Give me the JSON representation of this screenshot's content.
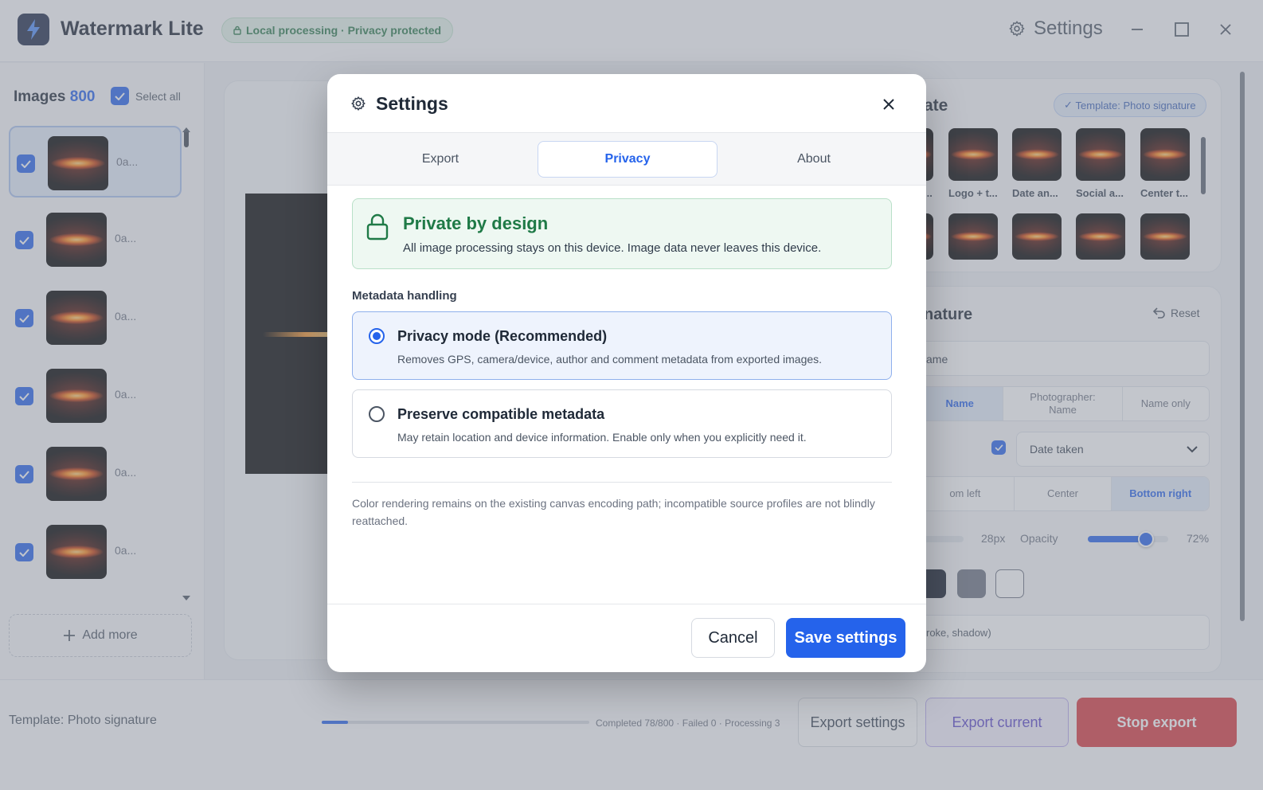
{
  "app": {
    "title": "Watermark Lite",
    "local_badge": "Local processing · Privacy protected",
    "settings_label": "Settings"
  },
  "left_panel": {
    "images_label": "Images",
    "images_count": "800",
    "select_all": "Select all",
    "thumb_name": "0a...",
    "add_more": "Add more"
  },
  "template_panel": {
    "title_fragment": "ate",
    "badge": "Template: Photo signature",
    "templates": [
      "...",
      "Logo + t...",
      "Date an...",
      "Social a...",
      "Center t..."
    ]
  },
  "signature_panel": {
    "title_fragment": "nature",
    "reset": "Reset",
    "name_input": "ame",
    "format_options": [
      "Name",
      "Photographer: Name",
      "Name only"
    ],
    "date_select": "Date taken",
    "position_options": [
      "om left",
      "Center",
      "Bottom right"
    ],
    "size_value": "28px",
    "opacity_label": "Opacity",
    "opacity_value": "72%",
    "opacity_level": 0.72,
    "effects_fragment": "roke, shadow)"
  },
  "bottom_bar": {
    "template_label": "Template: Photo signature",
    "progress_fraction": 0.0975,
    "status": "Completed 78/800 · Failed 0 · Processing 3",
    "export_settings": "Export settings",
    "export_current": "Export current",
    "stop_export": "Stop export"
  },
  "modal": {
    "title": "Settings",
    "tabs": [
      "Export",
      "Privacy",
      "About"
    ],
    "active_tab": "Privacy",
    "privacy_box": {
      "title": "Private by design",
      "subtitle": "All image processing stays on this device. Image data never leaves this device."
    },
    "metadata_label": "Metadata handling",
    "options": [
      {
        "title": "Privacy mode (Recommended)",
        "subtitle": "Removes GPS, camera/device, author and comment metadata from exported images.",
        "selected": true
      },
      {
        "title": "Preserve compatible metadata",
        "subtitle": "May retain location and device information. Enable only when you explicitly need it.",
        "selected": false
      }
    ],
    "note": "Color rendering remains on the existing canvas encoding path; incompatible source profiles are not blindly reattached.",
    "cancel": "Cancel",
    "save": "Save settings"
  },
  "colors": {
    "accent": "#2563eb",
    "success": "#1f7a47",
    "danger": "#d9383f"
  }
}
